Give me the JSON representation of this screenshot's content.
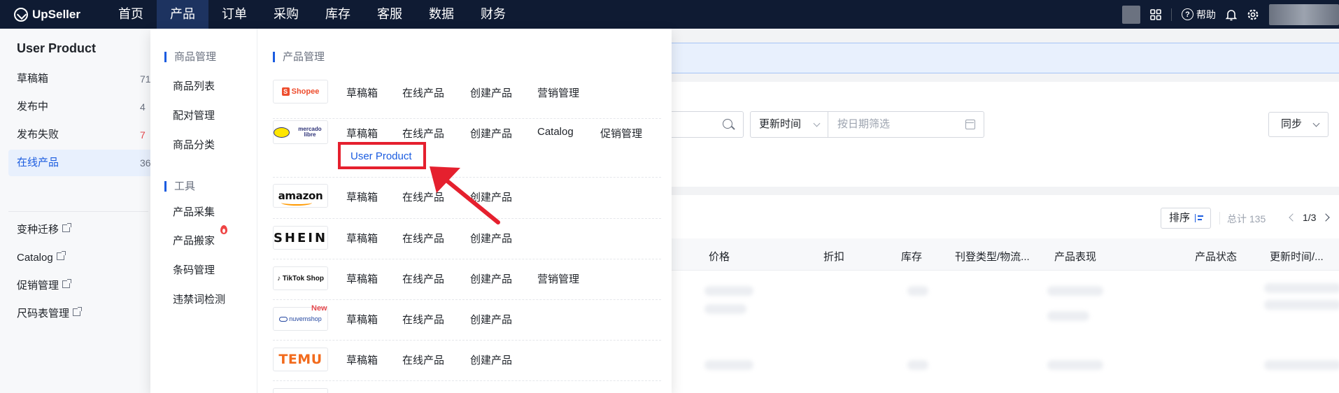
{
  "brand": {
    "name": "UpSeller"
  },
  "topnav": {
    "items": [
      "首页",
      "产品",
      "订单",
      "采购",
      "库存",
      "客服",
      "数据",
      "财务"
    ],
    "active_index": 1,
    "help_label": "帮助"
  },
  "sidebar": {
    "title": "User Product",
    "items": [
      {
        "label": "草稿箱",
        "count": "71"
      },
      {
        "label": "发布中",
        "count": "4"
      },
      {
        "label": "发布失败",
        "count": "7"
      },
      {
        "label": "在线产品",
        "count": "36"
      }
    ],
    "links": [
      "变种迁移",
      "Catalog",
      "促销管理",
      "尺码表管理"
    ]
  },
  "dropdown": {
    "goods_group_title": "商品管理",
    "goods_links": [
      "商品列表",
      "配对管理",
      "商品分类"
    ],
    "tools_group_title": "工具",
    "tools_links": [
      "产品采集",
      "产品搬家",
      "条码管理",
      "违禁词检测"
    ],
    "product_mgmt_title": "产品管理",
    "platforms": [
      {
        "logo_text": "Shopee",
        "icon": "shopee-logo",
        "links": [
          "草稿箱",
          "在线产品",
          "创建产品",
          "营销管理"
        ]
      },
      {
        "logo_text": "mercado libre",
        "icon": "mercado-libre-logo",
        "links": [
          "草稿箱",
          "在线产品",
          "创建产品",
          "Catalog",
          "促销管理"
        ],
        "extra_link": "User Product"
      },
      {
        "logo_text": "amazon",
        "icon": "amazon-logo",
        "links": [
          "草稿箱",
          "在线产品",
          "创建产品"
        ]
      },
      {
        "logo_text": "SHEIN",
        "icon": "shein-logo",
        "links": [
          "草稿箱",
          "在线产品",
          "创建产品"
        ]
      },
      {
        "logo_text": "TikTok Shop",
        "icon": "tiktok-shop-logo",
        "links": [
          "草稿箱",
          "在线产品",
          "创建产品",
          "营销管理"
        ]
      },
      {
        "logo_text": "nuvemshop",
        "icon": "nuvemshop-logo",
        "badge": "New",
        "links": [
          "草稿箱",
          "在线产品",
          "创建产品"
        ]
      },
      {
        "logo_text": "TEMU",
        "icon": "temu-logo",
        "links": [
          "草稿箱",
          "在线产品",
          "创建产品"
        ]
      }
    ]
  },
  "filters": {
    "time_select": "更新时间",
    "date_placeholder": "按日期筛选",
    "sync_label": "同步"
  },
  "table": {
    "sort_label": "排序",
    "total_label": "总计 135",
    "page_info": "1/3",
    "columns": [
      "价格",
      "折扣",
      "库存",
      "刊登类型/物流...",
      "产品表现",
      "产品状态",
      "更新时间/..."
    ]
  },
  "colors": {
    "nav_bg": "#0f1b33",
    "accent": "#1b5ce0",
    "highlight": "#e5202e"
  }
}
